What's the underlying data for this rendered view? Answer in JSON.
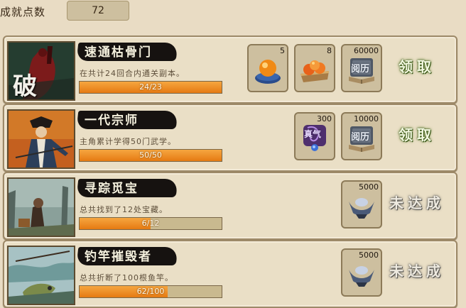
{
  "header": {
    "score_label": "成就点数",
    "score_value": "72"
  },
  "achievements": [
    {
      "title": "速通枯骨门",
      "art_text": "破",
      "description": "在共计24回合内通关副本。",
      "progress_text": "24/23",
      "progress": 1.0,
      "rewards": [
        {
          "icon": "orange-orb-icon",
          "count": "5"
        },
        {
          "icon": "orange-fruit-plate-icon",
          "count": "8"
        },
        {
          "icon": "experience-book-icon",
          "count": "60000",
          "label": "阅历"
        }
      ],
      "action": "领取",
      "action_state": "claimable"
    },
    {
      "title": "一代宗师",
      "description": "主角累计学得50门武学。",
      "progress_text": "50/50",
      "progress": 1.0,
      "rewards": [
        {
          "icon": "purple-qi-orb-icon",
          "count": "300",
          "label": "真气"
        },
        {
          "icon": "experience-book-icon",
          "count": "10000",
          "label": "阅历"
        }
      ],
      "action": "领取",
      "action_state": "claimable"
    },
    {
      "title": "寻踪觅宝",
      "description": "总共找到了12处宝藏。",
      "progress_text": "6/12",
      "progress": 0.5,
      "rewards": [
        {
          "icon": "silver-ingot-icon",
          "count": "5000"
        }
      ],
      "action": "未达成",
      "action_state": "not-achieved"
    },
    {
      "title": "钓竿摧毁者",
      "description": "总共折断了100根鱼竿。",
      "progress_text": "62/100",
      "progress": 0.62,
      "rewards": [
        {
          "icon": "silver-ingot-icon",
          "count": "5000"
        }
      ],
      "action": "未达成",
      "action_state": "not-achieved"
    }
  ],
  "colors": {
    "background": "#e9dcc4",
    "progress_fill": "#e57a12",
    "claim_green": "#4c7418",
    "pending_gray": "#6f6d68"
  }
}
